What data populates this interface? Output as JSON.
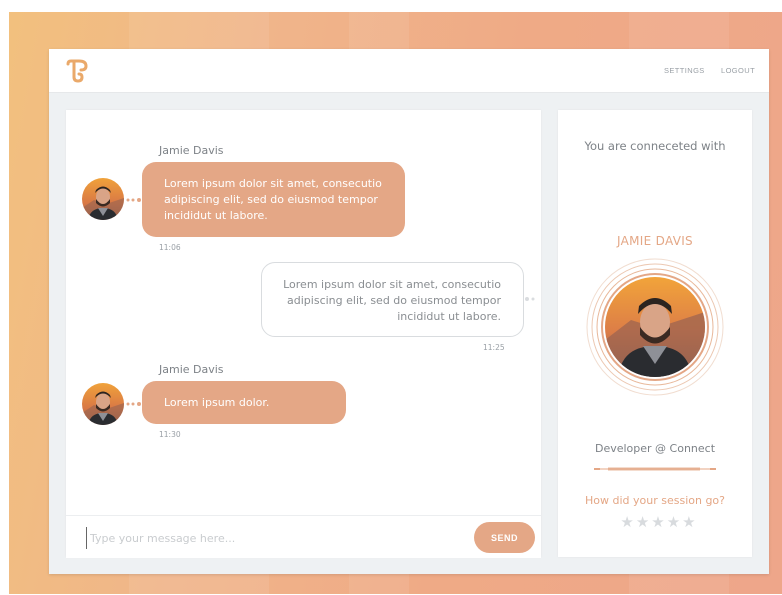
{
  "nav": {
    "settings": "SETTINGS",
    "logout": "LOGOUT"
  },
  "logo": {
    "icon": "t-logo-icon"
  },
  "messages": [
    {
      "direction": "incoming",
      "sender": "Jamie Davis",
      "text": "Lorem ipsum dolor sit amet, consecutio adipiscing elit, sed do eiusmod tempor incididut ut labore.",
      "time": "11:06"
    },
    {
      "direction": "outgoing",
      "sender": "",
      "text": "Lorem ipsum dolor sit amet, consecutio adipiscing elit, sed do eiusmod tempor incididut ut labore.",
      "time": "11:25"
    },
    {
      "direction": "incoming",
      "sender": "Jamie Davis",
      "text": "Lorem ipsum dolor.",
      "time": "11:30"
    }
  ],
  "composer": {
    "placeholder": "Type your message here...",
    "send_label": "SEND"
  },
  "profile": {
    "connected_label": "You are conneceted with",
    "name": "JAMIE DAVIS",
    "role": "Developer @  Connect",
    "rating_question": "How did your session go?",
    "rating_value": 0,
    "rating_max": 5
  },
  "colors": {
    "accent": "#e4a786",
    "background_start": "#f2c07e",
    "background_end": "#eea68a"
  }
}
